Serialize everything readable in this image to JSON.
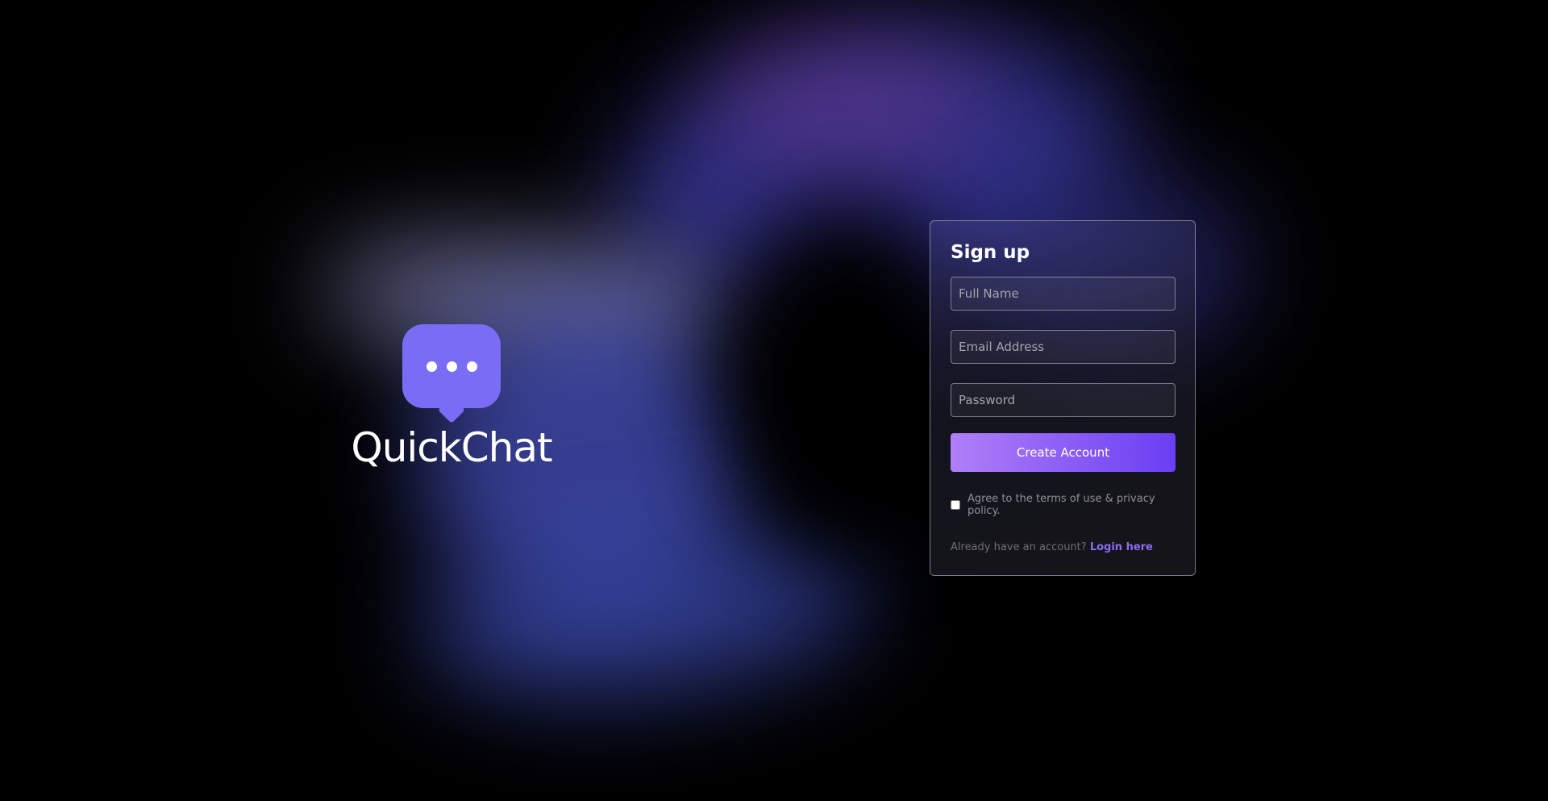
{
  "app": {
    "name": "QuickChat",
    "logo_icon": "chat-bubble-icon"
  },
  "signup": {
    "title": "Sign up",
    "full_name_placeholder": "Full Name",
    "email_placeholder": "Email Address",
    "password_placeholder": "Password",
    "submit_label": "Create Account",
    "terms_label": "Agree to the terms of use & privacy policy.",
    "terms_checked": false,
    "login_prompt": "Already have an account?",
    "login_link": "Login here"
  },
  "colors": {
    "accent": "#7b6cf6",
    "button_gradient_start": "#b07ff8",
    "button_gradient_end": "#6a3ef3",
    "link": "#8a6cf7"
  }
}
